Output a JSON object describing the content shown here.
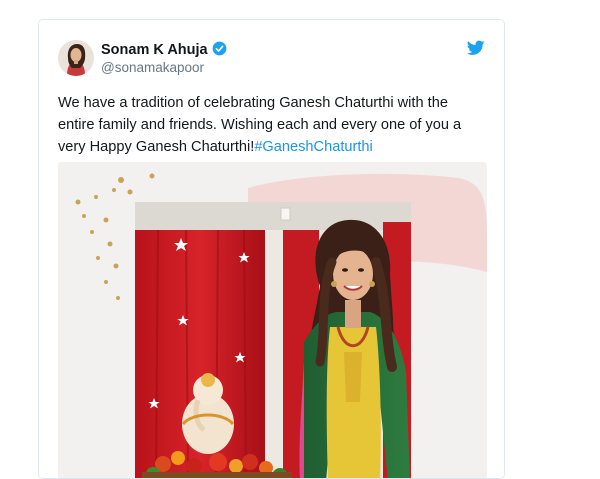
{
  "author": {
    "name": "Sonam K Ahuja",
    "handle": "@sonamakapoor",
    "verified": true
  },
  "tweet": {
    "text": "We have a tradition of celebrating Ganesh Chaturthi with the entire family and friends. Wishing each and every one of you a very Happy Ganesh Chaturthi!",
    "hashtag": "#GaneshChaturthi"
  },
  "icons": {
    "verified": "verified-badge-icon",
    "brand": "twitter-bird-icon"
  },
  "colors": {
    "link": "#1b95e0",
    "text": "#14171a",
    "secondary": "#657786",
    "border": "#e1e8ed",
    "verified": "#1da1f2"
  }
}
